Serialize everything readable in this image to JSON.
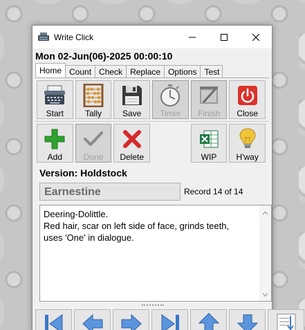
{
  "window": {
    "title": "Write Click"
  },
  "datetime": "Mon 02-Jun(06)-2025   00:00:10",
  "tabs": [
    {
      "label": "Home",
      "active": true
    },
    {
      "label": "Count"
    },
    {
      "label": "Check"
    },
    {
      "label": "Replace"
    },
    {
      "label": "Options"
    },
    {
      "label": "Test"
    }
  ],
  "toolbar1": [
    {
      "label": "Start",
      "icon": "typewriter-icon"
    },
    {
      "label": "Tally",
      "icon": "abacus-icon"
    },
    {
      "label": "Save",
      "icon": "floppy-disk-icon"
    },
    {
      "label": "Timer",
      "icon": "stopwatch-icon",
      "disabled": true
    },
    {
      "label": "Finish",
      "icon": "finish-flag-icon",
      "disabled": true
    },
    {
      "label": "Close",
      "icon": "power-icon"
    }
  ],
  "toolbar2": [
    {
      "label": "Add",
      "icon": "plus-icon"
    },
    {
      "label": "Done",
      "icon": "checkmark-icon",
      "disabled": true
    },
    {
      "label": "Delete",
      "icon": "delete-x-icon"
    },
    {
      "label": "WIP",
      "icon": "excel-icon"
    },
    {
      "label": "H'way",
      "icon": "lightbulb-icon"
    }
  ],
  "version": "Version: Holdstock",
  "character_name": "Earnestine",
  "record": "Record 14 of 14",
  "notes": "Deering-Dolittle.\nRed hair, scar on left side of face, grinds teeth,\nuses 'One' in dialogue.",
  "colors": {
    "close_red": "#d9332b",
    "add_green": "#2fa12f",
    "delete_red": "#d42a2a",
    "nav_blue": "#3c78c8"
  },
  "nav_buttons": [
    "first-record-icon",
    "previous-record-icon",
    "next-record-icon",
    "last-record-icon",
    "move-up-icon",
    "move-down-icon",
    "list-down-icon"
  ]
}
